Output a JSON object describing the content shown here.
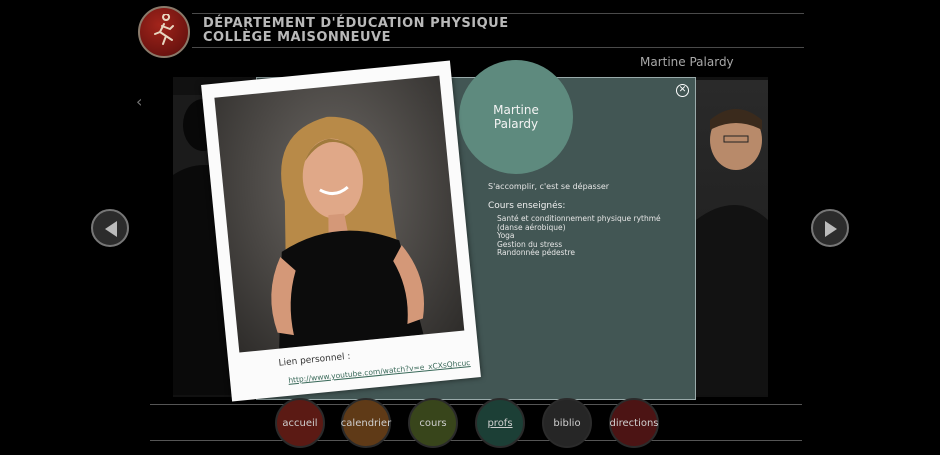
{
  "header": {
    "line1": "Département d'éducation physique",
    "line2": "Collège Maisonneuve"
  },
  "person_name_top": "Martine Palardy",
  "modal": {
    "name": "Martine Palardy",
    "motto": "S'accomplir, c'est se dépasser",
    "courses_title": "Cours enseignés:",
    "courses": [
      "Santé et conditionnement physique rythmé (danse aérobique)",
      "Yoga",
      "Gestion du stress",
      "Randonnée pédestre"
    ],
    "close_icon": "close-icon"
  },
  "polaroid": {
    "link_label": "Lien personnel :",
    "link_url": "http://www.youtube.com/watch?v=e_xCXsQhcuc"
  },
  "nav": [
    {
      "label": "accueil",
      "color": "#5b1a14"
    },
    {
      "label": "calendrier",
      "color": "#5f3a17"
    },
    {
      "label": "cours",
      "color": "#38451b"
    },
    {
      "label": "profs",
      "color": "#1c3f36"
    },
    {
      "label": "biblio",
      "color": "#262626"
    },
    {
      "label": "directions",
      "color": "#4c1414"
    }
  ],
  "icons": {
    "prev": "chevron-left-icon",
    "next": "arrow-right-icon",
    "logo": "runner-logo-icon"
  }
}
